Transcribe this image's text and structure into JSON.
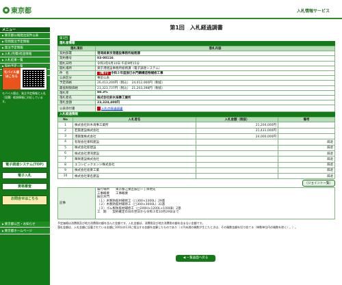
{
  "header": {
    "logo_text": "東京都",
    "service_name": "入札情報サービス"
  },
  "sidebar": {
    "menu_title": "メニュー",
    "items": [
      "東京都公報発注案件公表",
      "年間発注予定情報",
      "発注予定情報",
      "入札(見積)経過情報",
      "入札結果一覧",
      "契約予定一覧",
      "入札参加資格情報"
    ],
    "mobile_title": "モバイル版はこちら",
    "mobile_note": "モバイル版は、発注予定情報と入札（見積）経過情報に対応しています。",
    "links": [
      "電子調達システム(TOP)",
      "電子入札",
      "資格審査",
      "お問合せはこちら"
    ],
    "bottom_items": [
      "東京都ホームページ"
    ],
    "bottom_title": "東京都公告・お知らせ"
  },
  "page": {
    "title": "第1回　入札経過調書",
    "round_tab": "第1回"
  },
  "info": {
    "section_title": "落札者情報",
    "col_item": "落札項目",
    "col_content": "落札内容",
    "rows": [
      {
        "label": "契約部署",
        "value": "港湾局東京港建設事務所総務課"
      },
      {
        "label": "契約番号",
        "value": "03-00116"
      },
      {
        "label": "開札日時",
        "value": "令和3年6月10日 午前9時15分"
      },
      {
        "label": "開札場所",
        "value": "東京港建設事務所総務課（電子調達システム）"
      },
      {
        "label": "件　名",
        "tag": "【電子】",
        "value": "令和３年度辰巳水門鋼構造物補修工事"
      },
      {
        "label": "公表区分",
        "value": "事前公表"
      },
      {
        "label": "予定価格",
        "value": "26,413,200円（税込）　24,012,000円（税抜）"
      },
      {
        "label": "最低制限価格",
        "value": "23,323,737円（税込）　21,203,398円（税抜）"
      },
      {
        "label": "落札率",
        "value": "88.3%"
      },
      {
        "label": "落札者名",
        "value": "株式会社鈴木海事工業所"
      },
      {
        "label": "落札金額",
        "value": "23,324,400円"
      },
      {
        "label": "公表添付書",
        "link": "入札の経過調書"
      }
    ]
  },
  "result": {
    "section_title": "入札経過情報",
    "headers": [
      "No",
      "入札者名",
      "入札金額（税抜）",
      "備考"
    ],
    "rows": [
      {
        "no": "1",
        "name": "株式会社鈴木海事工業所",
        "amount": "21,204,000円",
        "note": ""
      },
      {
        "no": "2",
        "name": "若築建設株式会社",
        "amount": "21,431,000円",
        "note": ""
      },
      {
        "no": "3",
        "name": "港興業株式会社",
        "amount": "24,000,000円",
        "note": ""
      },
      {
        "no": "4",
        "name": "有限会社東和建設",
        "amount": "",
        "note": "辞退"
      },
      {
        "no": "5",
        "name": "株式会社新建設",
        "amount": "",
        "note": "辞退"
      },
      {
        "no": "6",
        "name": "株式会社港湾建設",
        "amount": "",
        "note": "辞退"
      },
      {
        "no": "7",
        "name": "陣栄建設株式会社",
        "amount": "",
        "note": "辞退"
      },
      {
        "no": "8",
        "name": "エコシビックエンジ株式会社",
        "amount": "",
        "note": "辞退"
      },
      {
        "no": "9",
        "name": "株式会社坂東工業",
        "amount": "",
        "note": "辞退"
      },
      {
        "no": "10",
        "name": "株式会社東名建設",
        "amount": "",
        "note": "辞退"
      }
    ],
    "joint_button": "（ジョイント一覧）"
  },
  "remarks": {
    "label": "記事",
    "text": "履行場所　　東京都江東区辰巳一丁目地先\n工事概要　　工事概要\n辰巳水門\n（１）木製防舷材補修工（□300×3300L）29基\n（２）木製防舷材補修工（□300×3000L）31基\n（３）ゴム製防舷材補修工（□200H×1200L×1000B）2基\n工　期　　契約確定の日の翌日から令和３年10月29日まで"
  },
  "notes": {
    "line1": "予定価格は消費税及び地方消費税の額を含んだ金額です。入札金額は、消費税及び地方消費税の額を含まない金額です。",
    "line2": "落札金額は、入札金額に記載されている金額に100分の110に相当する金額を加算したものであり（１円未満の端数が生じたときは、その端数金額を切り捨てる（単数単位円の端数を除く）。）。"
  },
  "back_button": "一覧画面へ戻る"
}
